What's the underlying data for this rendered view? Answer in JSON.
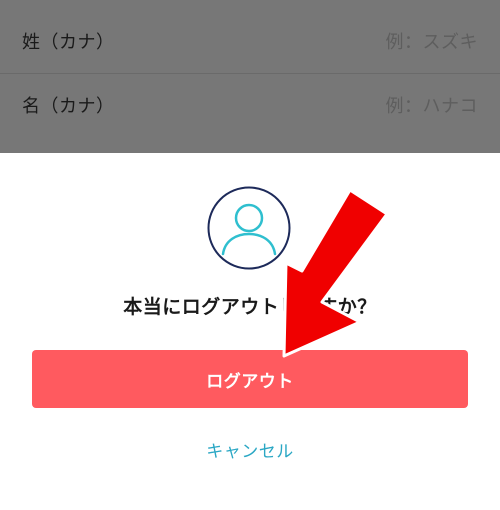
{
  "form": {
    "rows": [
      {
        "label": "姓（カナ）",
        "placeholder": "例：スズキ"
      },
      {
        "label": "名（カナ）",
        "placeholder": "例：ハナコ"
      }
    ]
  },
  "dialog": {
    "avatar_icon": "user-avatar-icon",
    "title": "本当にログアウトしますか？",
    "logout_label": "ログアウト",
    "cancel_label": "キャンセル"
  },
  "colors": {
    "accent": "#ff5a5f",
    "cancel": "#2aa7c4",
    "arrow": "#f00000",
    "avatar_stroke": "#2fbfcf",
    "avatar_ring": "#1d2a5a"
  }
}
